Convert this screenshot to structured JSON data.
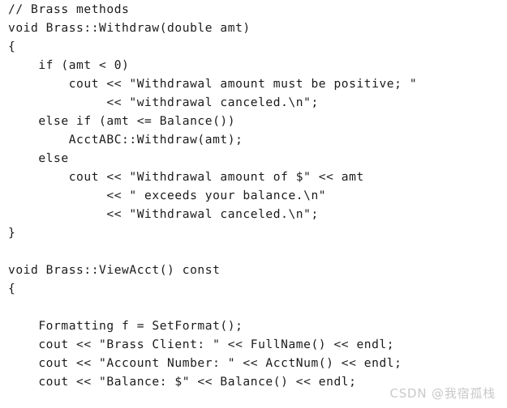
{
  "document": {
    "type": "scanned-code-listing",
    "language": "C++",
    "background_color": "#ffffff",
    "text_color": "#1b1b1b",
    "lines": [
      "// Brass methods",
      "void Brass::Withdraw(double amt)",
      "{",
      "    if (amt < 0)",
      "        cout << \"Withdrawal amount must be positive; \"",
      "             << \"withdrawal canceled.\\n\";",
      "    else if (amt <= Balance())",
      "        AcctABC::Withdraw(amt);",
      "    else",
      "        cout << \"Withdrawal amount of $\" << amt",
      "             << \" exceeds your balance.\\n\"",
      "             << \"Withdrawal canceled.\\n\";",
      "}",
      "",
      "void Brass::ViewAcct() const",
      "{",
      "",
      "    Formatting f = SetFormat();",
      "    cout << \"Brass Client: \" << FullName() << endl;",
      "    cout << \"Account Number: \" << AcctNum() << endl;",
      "    cout << \"Balance: $\" << Balance() << endl;"
    ]
  },
  "watermark": {
    "text": "CSDN @我宿孤栈",
    "color": "#c9c9c9"
  }
}
